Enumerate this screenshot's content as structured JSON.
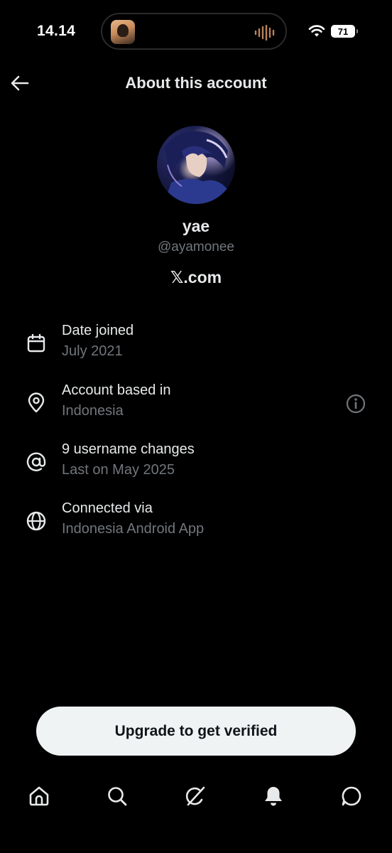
{
  "status_bar": {
    "time": "14.14",
    "battery": "71",
    "icons": [
      "live-activity-thumbnail",
      "audio-wave-icon",
      "wifi-icon",
      "battery-icon"
    ]
  },
  "header": {
    "title": "About this account",
    "back_icon": "arrow-left-icon"
  },
  "profile": {
    "display_name": "yae",
    "handle": "@ayamonee",
    "site": "𝕏.com"
  },
  "info_items": [
    {
      "icon": "calendar-icon",
      "title": "Date joined",
      "subtitle": "July 2021"
    },
    {
      "icon": "location-pin-icon",
      "title": "Account based in",
      "subtitle": "Indonesia",
      "extra_icon": "info-icon"
    },
    {
      "icon": "at-sign-icon",
      "title": "9 username changes",
      "subtitle": "Last on May 2025"
    },
    {
      "icon": "globe-icon",
      "title": "Connected via",
      "subtitle": "Indonesia Android App"
    }
  ],
  "cta": {
    "label": "Upgrade to get verified"
  },
  "bottom_nav": [
    "home-icon",
    "search-icon",
    "grok-icon",
    "notifications-bell-icon",
    "messages-icon"
  ],
  "colors": {
    "background": "#000000",
    "primary_text": "#e7e9ea",
    "secondary_text": "#71767b",
    "button_bg": "#eff3f4",
    "button_text": "#0f1419"
  }
}
